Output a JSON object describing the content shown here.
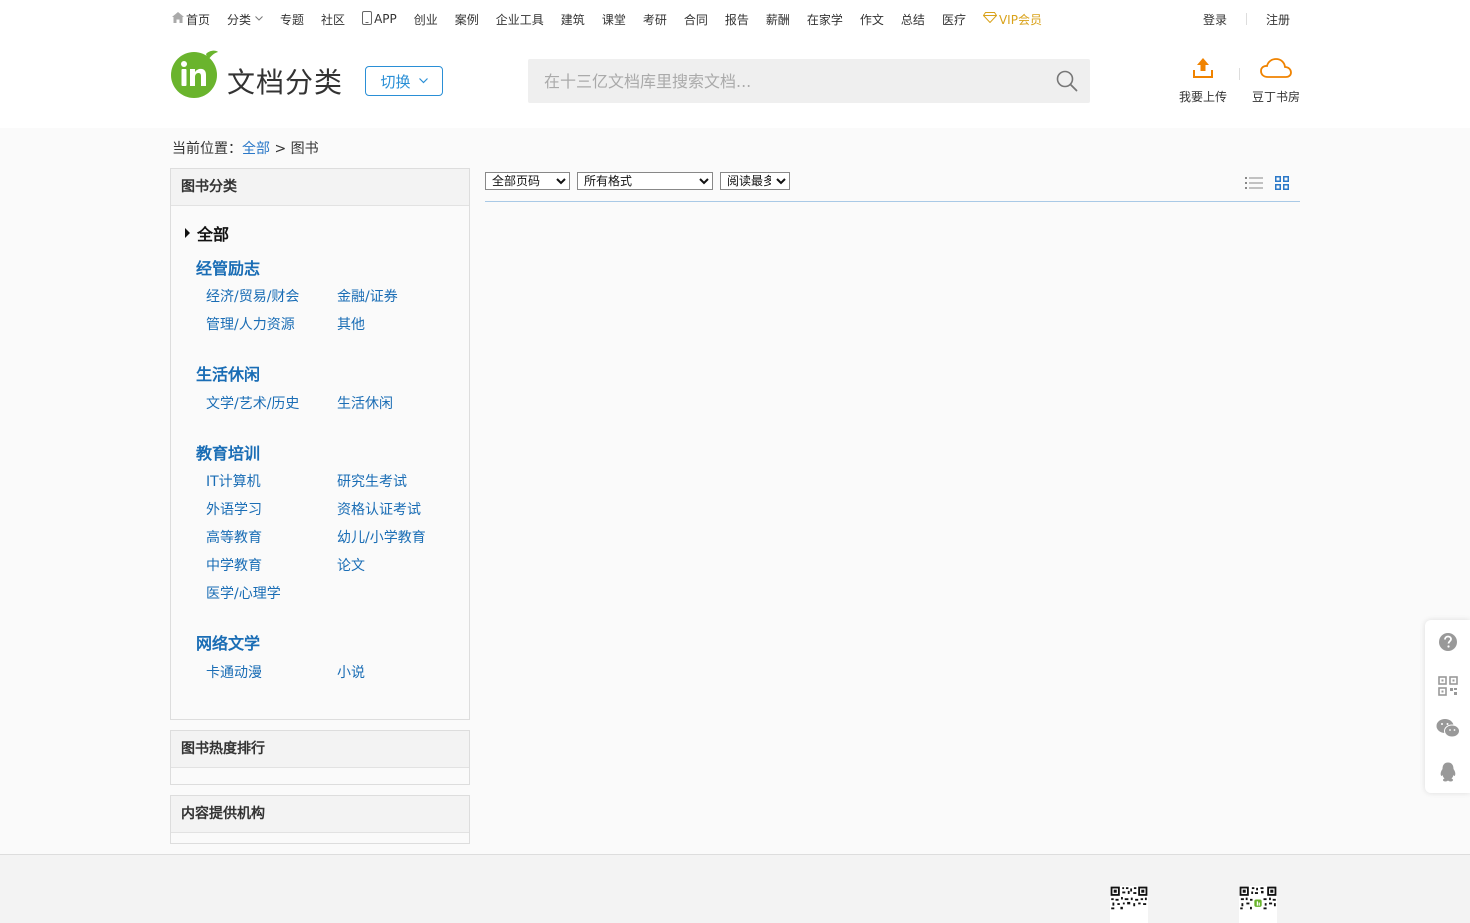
{
  "topnav": {
    "items": [
      {
        "label": "首页",
        "icon": "home-icon"
      },
      {
        "label": "分类",
        "dropdown": true
      },
      {
        "label": "专题"
      },
      {
        "label": "社区"
      },
      {
        "label": "APP",
        "icon": "phone-icon"
      },
      {
        "label": "创业"
      },
      {
        "label": "案例"
      },
      {
        "label": "企业工具"
      },
      {
        "label": "建筑"
      },
      {
        "label": "课堂"
      },
      {
        "label": "考研"
      },
      {
        "label": "合同"
      },
      {
        "label": "报告"
      },
      {
        "label": "薪酬"
      },
      {
        "label": "在家学"
      },
      {
        "label": "作文"
      },
      {
        "label": "总结"
      },
      {
        "label": "医疗"
      }
    ],
    "vip_label": "VIP会员",
    "login": "登录",
    "register": "注册"
  },
  "header": {
    "logo_text": "文档分类",
    "switch_label": "切换",
    "search_placeholder": "在十三亿文档库里搜索文档...",
    "upload_label": "我要上传",
    "bookroom_label": "豆丁书房"
  },
  "breadcrumb": {
    "prefix": "当前位置：",
    "all": "全部",
    "sep": " > ",
    "current": "图书"
  },
  "sidebar": {
    "category_title": "图书分类",
    "all_label": "全部",
    "groups": [
      {
        "title": "经管励志",
        "items": [
          "经济/贸易/财会",
          "金融/证券",
          "管理/人力资源",
          "其他"
        ]
      },
      {
        "title": "生活休闲",
        "items": [
          "文学/艺术/历史",
          "生活休闲"
        ]
      },
      {
        "title": "教育培训",
        "items": [
          "IT计算机",
          "研究生考试",
          "外语学习",
          "资格认证考试",
          "高等教育",
          "幼儿/小学教育",
          "中学教育",
          "论文",
          "医学/心理学"
        ]
      },
      {
        "title": "网络文学",
        "items": [
          "卡通动漫",
          "小说"
        ]
      }
    ],
    "ranking_title": "图书热度排行",
    "provider_title": "内容提供机构"
  },
  "filters": {
    "pages": "全部页码",
    "format": "所有格式",
    "sort": "阅读最多"
  },
  "colors": {
    "link": "#1a6db5",
    "accent_orange": "#f08300",
    "vip": "#d9a21a",
    "logo_green": "#6ab42d"
  }
}
